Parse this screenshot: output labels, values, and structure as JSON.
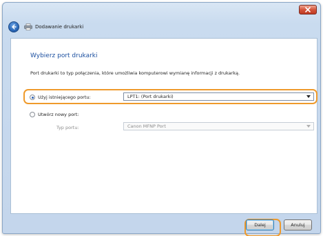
{
  "window": {
    "header_title": "Dodawanie drukarki"
  },
  "page": {
    "title": "Wybierz port drukarki",
    "description": "Port drukarki to typ połączenia, które umożliwia komputerowi wymianę informacji z drukarką."
  },
  "existing_port": {
    "label": "Użyj istniejącego portu:",
    "selected": true,
    "value": "LPT1: (Port drukarki)"
  },
  "new_port": {
    "label": "Utwórz nowy port:",
    "selected": false,
    "type_label": "Typ portu:",
    "type_value": "Canon MFNP Port"
  },
  "buttons": {
    "next_label": "Dalej",
    "cancel_label": "Anuluj"
  },
  "colors": {
    "highlight": "#ef9a2b",
    "title_blue": "#1a4e9f",
    "close_red": "#c03b22"
  }
}
